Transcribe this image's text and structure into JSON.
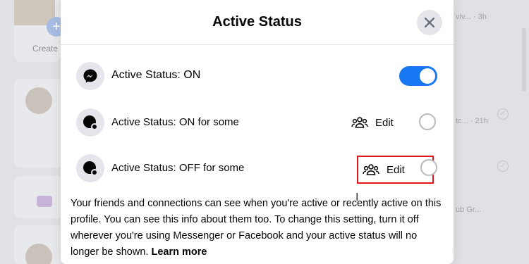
{
  "background": {
    "create_label": "Create",
    "right_snippets": [
      {
        "text": "viv... · 3h"
      },
      {
        "text": "tc... · 21h"
      },
      {
        "text": "ub Gr..."
      }
    ]
  },
  "modal": {
    "title": "Active Status",
    "options": [
      {
        "label": "Active Status: ON",
        "control": "toggle",
        "toggle_on": true
      },
      {
        "label": "Active Status: ON for some",
        "edit_label": "Edit",
        "control": "radio"
      },
      {
        "label": "Active Status: OFF for some",
        "edit_label": "Edit",
        "control": "radio",
        "edit_highlighted": true
      }
    ],
    "description": "Your friends and connections can see when you're active or recently active on this profile. You can see this info about them too. To change this setting, turn it off wherever you're using Messenger or Facebook and your active status will no longer be shown.",
    "learn_more": "Learn more"
  },
  "colors": {
    "toggle_on": "#1877f2",
    "highlight_box": "#e0171b"
  }
}
